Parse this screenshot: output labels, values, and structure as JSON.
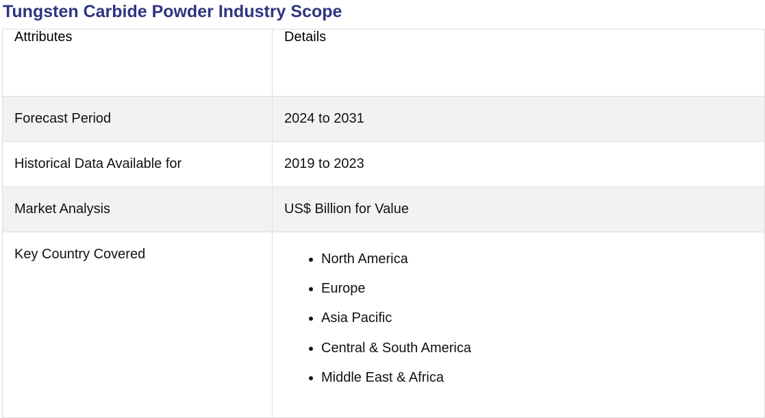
{
  "title": "Tungsten Carbide Powder Industry Scope",
  "table": {
    "headers": [
      "Attributes",
      "Details"
    ],
    "rows": [
      {
        "attribute": "Forecast Period",
        "detail": "2024 to 2031"
      },
      {
        "attribute": "Historical Data Available for",
        "detail": "2019 to 2023"
      },
      {
        "attribute": "Market Analysis",
        "detail": "US$ Billion for Value"
      }
    ],
    "key_country": {
      "attribute": "Key Country Covered",
      "regions": [
        "North America",
        "Europe",
        "Asia Pacific",
        "Central & South America",
        "Middle East & Africa"
      ]
    }
  },
  "colors": {
    "title": "#2e3580",
    "shaded_row": "#f2f2f2",
    "border": "#dddddd"
  }
}
